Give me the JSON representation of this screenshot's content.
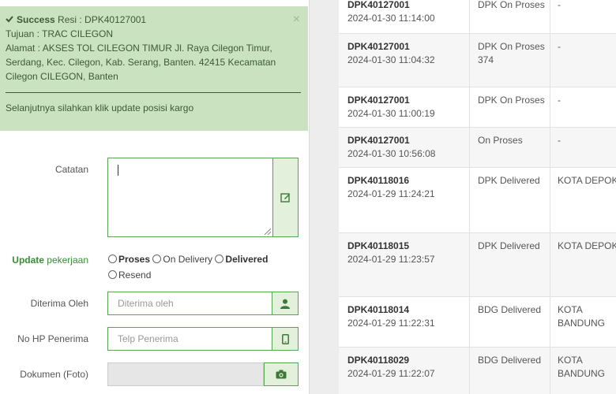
{
  "alert": {
    "success_label": "Success",
    "resi_text": " Resi : DPK40127001",
    "tujuan": "Tujuan : TRAC CILEGON",
    "alamat": "Alamat : AKSES TOL CILEGON TIMUR Jl. Raya Cilegon Timur, Serdang, Kec. Cilegon, Kab. Serang, Banten. 42415 Kecamatan Cilegon CILEGON, Banten",
    "next_step": "Selanjutnya silahkan klik update posisi kargo",
    "close": "×"
  },
  "form": {
    "catatan_label": "Catatan",
    "update_bold": "Update",
    "update_rest": " pekerjaan",
    "radio_options": [
      "Proses",
      "On Delivery",
      "Delivered",
      "Resend"
    ],
    "diterima_label": "Diterima Oleh",
    "diterima_placeholder": "Diterima oleh",
    "nohp_label": "No HP Penerima",
    "nohp_placeholder": "Telp Penerima",
    "dokumen_label": "Dokumen (Foto)"
  },
  "table": {
    "rows": [
      {
        "resi": "DPK40127001",
        "time": "2024-01-30 11:14:00",
        "status": "DPK On Proses",
        "extra": "",
        "dest": "-"
      },
      {
        "resi": "DPK40127001",
        "time": "2024-01-30 11:04:32",
        "status": "DPK On Proses",
        "extra": "374",
        "dest": "-"
      },
      {
        "resi": "DPK40127001",
        "time": "2024-01-30 11:00:19",
        "status": "DPK On Proses",
        "extra": "",
        "dest": "-"
      },
      {
        "resi": "DPK40127001",
        "time": "2024-01-30 10:56:08",
        "status": "On Proses",
        "extra": "",
        "dest": "-"
      },
      {
        "resi": "DPK40118016",
        "time": "2024-01-29 11:24:21",
        "status": "DPK Delivered",
        "extra": "",
        "dest": "KOTA DEPOK"
      },
      {
        "resi": "DPK40118015",
        "time": "2024-01-29 11:23:57",
        "status": "DPK Delivered",
        "extra": "",
        "dest": "KOTA DEPOK"
      },
      {
        "resi": "DPK40118014",
        "time": "2024-01-29 11:22:31",
        "status": "BDG Delivered",
        "extra": "",
        "dest": "KOTA BANDUNG"
      },
      {
        "resi": "DPK40118029",
        "time": "2024-01-29 11:22:07",
        "status": "BDG Delivered",
        "extra": "",
        "dest": "KOTA BANDUNG"
      }
    ]
  },
  "icons": {
    "check": "check-icon",
    "edit": "edit-icon",
    "user": "user-icon",
    "phone": "phone-icon",
    "camera": "camera-icon"
  },
  "colors": {
    "success_bg": "#cbe2c0",
    "accent_green": "#5aa352",
    "addon_bg": "#e2f0dc"
  }
}
